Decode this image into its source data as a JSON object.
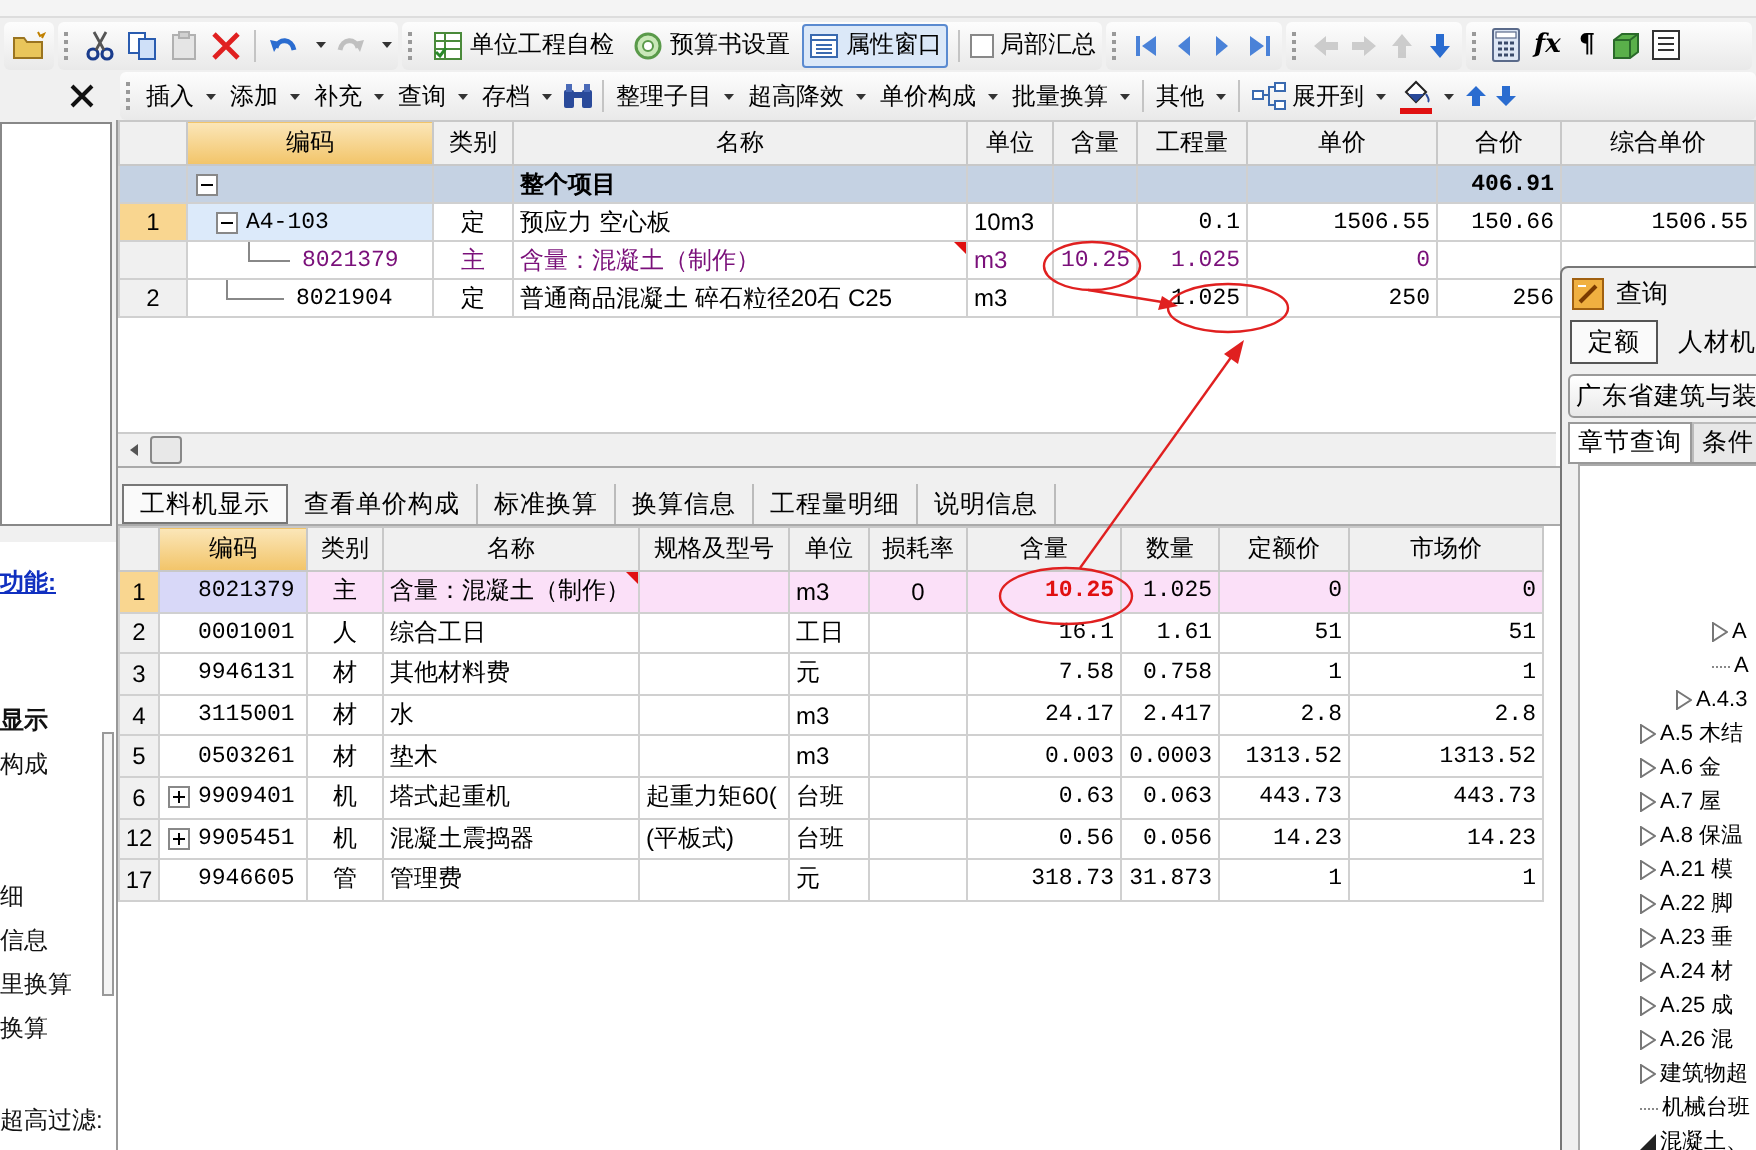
{
  "toolbar": {
    "edit_tools": [
      {
        "disabled": false
      },
      {
        "disabled": false
      },
      {
        "disabled": true
      },
      {
        "disabled": false
      }
    ],
    "history": [
      {
        "disabled": false
      },
      {
        "disabled": true
      }
    ],
    "commands": [
      {
        "label": "单位工程自检",
        "selected": false
      },
      {
        "label": "预算书设置",
        "selected": false
      },
      {
        "label": "属性窗口",
        "selected": true
      }
    ],
    "partial_summary": {
      "label": "局部汇总",
      "checked": false
    },
    "navigation": [
      {
        "disabled": false
      },
      {
        "disabled": false
      },
      {
        "disabled": false
      },
      {
        "disabled": false
      }
    ],
    "move_tools": [
      {
        "disabled": true
      },
      {
        "disabled": true
      },
      {
        "disabled": true
      },
      {
        "disabled": false
      }
    ],
    "text_tools": [
      "fx",
      "¶"
    ]
  },
  "menu_toolbar": {
    "groups": [
      [
        "插入",
        "添加",
        "补充",
        "查询",
        "存档"
      ],
      [
        "整理子目",
        "超高降效",
        "单价构成",
        "批量换算"
      ],
      [
        "其他"
      ]
    ],
    "expand_to": "展开到"
  },
  "left_panel": {
    "heading": "功能:",
    "groups": [
      [
        {
          "label": "显示",
          "selected": true
        },
        {
          "label": "构成",
          "selected": false
        }
      ],
      [
        {
          "label": "细",
          "selected": false
        },
        {
          "label": "信息",
          "selected": false
        },
        {
          "label": "里换算",
          "selected": false
        },
        {
          "label": "换算",
          "selected": false
        }
      ],
      [
        {
          "label": "超高过滤:",
          "selected": false
        }
      ]
    ]
  },
  "upper_grid": {
    "columns": [
      {
        "label": "编码",
        "active": true
      },
      {
        "label": "类别",
        "active": false
      },
      {
        "label": "名称",
        "active": false
      },
      {
        "label": "单位",
        "active": false
      },
      {
        "label": "含量",
        "active": false
      },
      {
        "label": "工程量",
        "active": false
      },
      {
        "label": "单价",
        "active": false
      },
      {
        "label": "合价",
        "active": false
      },
      {
        "label": "综合单价",
        "active": false
      }
    ],
    "rows": [
      {
        "kind": "group",
        "expanded": true,
        "selected": false,
        "flagged": false,
        "cells": [
          null,
          null,
          "整个项目",
          null,
          null,
          null,
          null,
          "406.91",
          null
        ]
      },
      {
        "kind": "parent",
        "expanded": true,
        "number": "1",
        "selected": true,
        "flagged": false,
        "cells": [
          "A4-103",
          "定",
          "预应力 空心板",
          "10m3",
          null,
          "0.1",
          "1506.55",
          "150.66",
          "1506.55"
        ]
      },
      {
        "kind": "child",
        "selected": false,
        "flagged": true,
        "cells": [
          "8021379",
          "主",
          "含量：混凝土（制作）",
          "m3",
          "10.25",
          "1.025",
          "0",
          null,
          null
        ]
      },
      {
        "kind": "leaf",
        "number": "2",
        "selected": false,
        "flagged": false,
        "cells": [
          "8021904",
          "定",
          "普通商品混凝土 碎石粒径20石 C25",
          "m3",
          null,
          "1.025",
          "250",
          "256",
          null
        ]
      }
    ]
  },
  "detail_tabs": [
    {
      "label": "工料机显示",
      "selected": true
    },
    {
      "label": "查看单价构成",
      "selected": false
    },
    {
      "label": "标准换算",
      "selected": false
    },
    {
      "label": "换算信息",
      "selected": false
    },
    {
      "label": "工程量明细",
      "selected": false
    },
    {
      "label": "说明信息",
      "selected": false
    }
  ],
  "lower_grid": {
    "columns": [
      {
        "label": "编码",
        "active": true
      },
      {
        "label": "类别",
        "active": false
      },
      {
        "label": "名称",
        "active": false
      },
      {
        "label": "规格及型号",
        "active": false
      },
      {
        "label": "单位",
        "active": false
      },
      {
        "label": "损耗率",
        "active": false
      },
      {
        "label": "含量",
        "active": false
      },
      {
        "label": "数量",
        "active": false
      },
      {
        "label": "定额价",
        "active": false
      },
      {
        "label": "市场价",
        "active": false
      }
    ],
    "rows": [
      {
        "number": "1",
        "selected": true,
        "has_children": false,
        "flagged": true,
        "cells": [
          "8021379",
          "主",
          "含量：混凝土（制作）",
          null,
          "m3",
          "0",
          "10.25",
          "1.025",
          "0",
          "0"
        ]
      },
      {
        "number": "2",
        "selected": false,
        "has_children": false,
        "flagged": false,
        "cells": [
          "0001001",
          "人",
          "综合工日",
          null,
          "工日",
          null,
          "16.1",
          "1.61",
          "51",
          "51"
        ]
      },
      {
        "number": "3",
        "selected": false,
        "has_children": false,
        "flagged": false,
        "cells": [
          "9946131",
          "材",
          "其他材料费",
          null,
          "元",
          null,
          "7.58",
          "0.758",
          "1",
          "1"
        ]
      },
      {
        "number": "4",
        "selected": false,
        "has_children": false,
        "flagged": false,
        "cells": [
          "3115001",
          "材",
          "水",
          null,
          "m3",
          null,
          "24.17",
          "2.417",
          "2.8",
          "2.8"
        ]
      },
      {
        "number": "5",
        "selected": false,
        "has_children": false,
        "flagged": false,
        "cells": [
          "0503261",
          "材",
          "垫木",
          null,
          "m3",
          null,
          "0.003",
          "0.0003",
          "1313.52",
          "1313.52"
        ]
      },
      {
        "number": "6",
        "selected": false,
        "has_children": true,
        "flagged": false,
        "cells": [
          "9909401",
          "机",
          "塔式起重机",
          "起重力矩60(",
          "台班",
          null,
          "0.63",
          "0.063",
          "443.73",
          "443.73"
        ]
      },
      {
        "number": "12",
        "selected": false,
        "has_children": true,
        "flagged": false,
        "cells": [
          "9905451",
          "机",
          "混凝土震捣器",
          "(平板式)",
          "台班",
          null,
          "0.56",
          "0.056",
          "14.23",
          "14.23"
        ]
      },
      {
        "number": "17",
        "selected": false,
        "has_children": false,
        "flagged": false,
        "cells": [
          "9946605",
          "管",
          "管理费",
          null,
          "元",
          null,
          "318.73",
          "31.873",
          "1",
          "1"
        ]
      }
    ]
  },
  "query_window": {
    "title": "查询",
    "tabs": [
      {
        "label": "定额",
        "selected": true
      },
      {
        "label": "人材机",
        "selected": false
      }
    ],
    "library": "广东省建筑与装",
    "subtabs": [
      {
        "label": "章节查询",
        "selected": true
      },
      {
        "label": "条件",
        "selected": false
      }
    ],
    "tree": [
      {
        "kind": "folder",
        "expanded": true,
        "children": [
          {
            "kind": "folder",
            "expanded": true,
            "children": [
              {
                "label": "A",
                "kind": "folder",
                "expanded": false
              },
              {
                "label": "A",
                "kind": "leaf"
              }
            ]
          },
          {
            "label": "A.4.3",
            "kind": "folder",
            "expanded": false
          }
        ]
      },
      {
        "label": "A.5 木结",
        "kind": "folder",
        "expanded": false
      },
      {
        "label": "A.6 金",
        "kind": "folder",
        "expanded": false
      },
      {
        "label": "A.7 屋",
        "kind": "folder",
        "expanded": false
      },
      {
        "label": "A.8 保温",
        "kind": "folder",
        "expanded": false
      },
      {
        "label": "A.21 模",
        "kind": "folder",
        "expanded": false
      },
      {
        "label": "A.22 脚",
        "kind": "folder",
        "expanded": false
      },
      {
        "label": "A.23 垂",
        "kind": "folder",
        "expanded": false
      },
      {
        "label": "A.24 材",
        "kind": "folder",
        "expanded": false
      },
      {
        "label": "A.25 成",
        "kind": "folder",
        "expanded": false
      },
      {
        "label": "A.26 混",
        "kind": "folder",
        "expanded": false
      },
      {
        "label": "建筑物超",
        "kind": "folder",
        "expanded": false
      },
      {
        "label": "机械台班",
        "kind": "leaf"
      },
      {
        "label": "混凝土、",
        "kind": "folder",
        "expanded": true
      }
    ]
  }
}
